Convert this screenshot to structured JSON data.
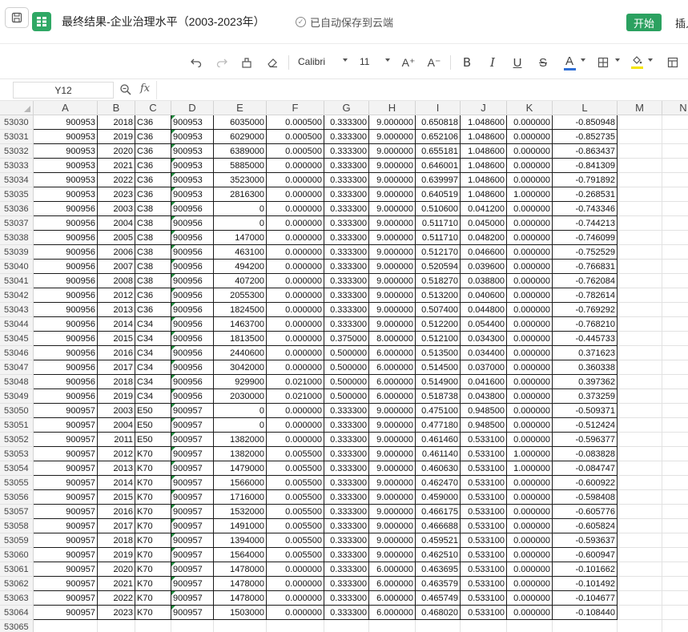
{
  "titlebar": {
    "doc_title": "最终结果-企业治理水平（2003-2023年）",
    "cloud_status": "已自动保存到云端",
    "start_label": "开始",
    "insert_label": "插入"
  },
  "toolbar": {
    "font_name": "Calibri",
    "font_size": "11",
    "bold": "B",
    "italic": "I",
    "underline": "U",
    "strike": "S",
    "font_color": "A",
    "increase_font": "A⁺",
    "decrease_font": "A⁻",
    "font_color_accent": "#2f6fd6",
    "fill_color_accent": "#f5e400"
  },
  "formula_bar": {
    "cell_ref": "Y12",
    "fx_label": "fx",
    "value": ""
  },
  "columns": [
    "A",
    "B",
    "C",
    "D",
    "E",
    "F",
    "G",
    "H",
    "I",
    "J",
    "K",
    "L",
    "M",
    "N"
  ],
  "rows": [
    {
      "n": "53030",
      "c": [
        "900953",
        "2018",
        "C36",
        "900953",
        "6035000",
        "0.000500",
        "0.333300",
        "9.000000",
        "0.650818",
        "1.048600",
        "0.000000",
        "-0.850948"
      ]
    },
    {
      "n": "53031",
      "c": [
        "900953",
        "2019",
        "C36",
        "900953",
        "6029000",
        "0.000500",
        "0.333300",
        "9.000000",
        "0.652106",
        "1.048600",
        "0.000000",
        "-0.852735"
      ]
    },
    {
      "n": "53032",
      "c": [
        "900953",
        "2020",
        "C36",
        "900953",
        "6389000",
        "0.000500",
        "0.333300",
        "9.000000",
        "0.655181",
        "1.048600",
        "0.000000",
        "-0.863437"
      ]
    },
    {
      "n": "53033",
      "c": [
        "900953",
        "2021",
        "C36",
        "900953",
        "5885000",
        "0.000000",
        "0.333300",
        "9.000000",
        "0.646001",
        "1.048600",
        "0.000000",
        "-0.841309"
      ]
    },
    {
      "n": "53034",
      "c": [
        "900953",
        "2022",
        "C36",
        "900953",
        "3523000",
        "0.000000",
        "0.333300",
        "9.000000",
        "0.639997",
        "1.048600",
        "0.000000",
        "-0.791892"
      ]
    },
    {
      "n": "53035",
      "c": [
        "900953",
        "2023",
        "C36",
        "900953",
        "2816300",
        "0.000000",
        "0.333300",
        "9.000000",
        "0.640519",
        "1.048600",
        "1.000000",
        "-0.268531"
      ]
    },
    {
      "n": "53036",
      "c": [
        "900956",
        "2003",
        "C38",
        "900956",
        "0",
        "0.000000",
        "0.333300",
        "9.000000",
        "0.510600",
        "0.041200",
        "0.000000",
        "-0.743346"
      ]
    },
    {
      "n": "53037",
      "c": [
        "900956",
        "2004",
        "C38",
        "900956",
        "0",
        "0.000000",
        "0.333300",
        "9.000000",
        "0.511710",
        "0.045000",
        "0.000000",
        "-0.744213"
      ]
    },
    {
      "n": "53038",
      "c": [
        "900956",
        "2005",
        "C38",
        "900956",
        "147000",
        "0.000000",
        "0.333300",
        "9.000000",
        "0.511710",
        "0.048200",
        "0.000000",
        "-0.746099"
      ]
    },
    {
      "n": "53039",
      "c": [
        "900956",
        "2006",
        "C38",
        "900956",
        "463100",
        "0.000000",
        "0.333300",
        "9.000000",
        "0.512170",
        "0.046600",
        "0.000000",
        "-0.752529"
      ]
    },
    {
      "n": "53040",
      "c": [
        "900956",
        "2007",
        "C38",
        "900956",
        "494200",
        "0.000000",
        "0.333300",
        "9.000000",
        "0.520594",
        "0.039600",
        "0.000000",
        "-0.766831"
      ]
    },
    {
      "n": "53041",
      "c": [
        "900956",
        "2008",
        "C38",
        "900956",
        "407200",
        "0.000000",
        "0.333300",
        "9.000000",
        "0.518270",
        "0.038800",
        "0.000000",
        "-0.762084"
      ]
    },
    {
      "n": "53042",
      "c": [
        "900956",
        "2012",
        "C36",
        "900956",
        "2055300",
        "0.000000",
        "0.333300",
        "9.000000",
        "0.513200",
        "0.040600",
        "0.000000",
        "-0.782614"
      ]
    },
    {
      "n": "53043",
      "c": [
        "900956",
        "2013",
        "C36",
        "900956",
        "1824500",
        "0.000000",
        "0.333300",
        "9.000000",
        "0.507400",
        "0.044800",
        "0.000000",
        "-0.769292"
      ]
    },
    {
      "n": "53044",
      "c": [
        "900956",
        "2014",
        "C34",
        "900956",
        "1463700",
        "0.000000",
        "0.333300",
        "9.000000",
        "0.512200",
        "0.054400",
        "0.000000",
        "-0.768210"
      ]
    },
    {
      "n": "53045",
      "c": [
        "900956",
        "2015",
        "C34",
        "900956",
        "1813500",
        "0.000000",
        "0.375000",
        "8.000000",
        "0.512100",
        "0.034300",
        "0.000000",
        "-0.445733"
      ]
    },
    {
      "n": "53046",
      "c": [
        "900956",
        "2016",
        "C34",
        "900956",
        "2440600",
        "0.000000",
        "0.500000",
        "6.000000",
        "0.513500",
        "0.034400",
        "0.000000",
        "0.371623"
      ]
    },
    {
      "n": "53047",
      "c": [
        "900956",
        "2017",
        "C34",
        "900956",
        "3042000",
        "0.000000",
        "0.500000",
        "6.000000",
        "0.514500",
        "0.037000",
        "0.000000",
        "0.360338"
      ]
    },
    {
      "n": "53048",
      "c": [
        "900956",
        "2018",
        "C34",
        "900956",
        "929900",
        "0.021000",
        "0.500000",
        "6.000000",
        "0.514900",
        "0.041600",
        "0.000000",
        "0.397362"
      ]
    },
    {
      "n": "53049",
      "c": [
        "900956",
        "2019",
        "C34",
        "900956",
        "2030000",
        "0.021000",
        "0.500000",
        "6.000000",
        "0.518738",
        "0.043800",
        "0.000000",
        "0.373259"
      ]
    },
    {
      "n": "53050",
      "c": [
        "900957",
        "2003",
        "E50",
        "900957",
        "0",
        "0.000000",
        "0.333300",
        "9.000000",
        "0.475100",
        "0.948500",
        "0.000000",
        "-0.509371"
      ]
    },
    {
      "n": "53051",
      "c": [
        "900957",
        "2004",
        "E50",
        "900957",
        "0",
        "0.000000",
        "0.333300",
        "9.000000",
        "0.477180",
        "0.948500",
        "0.000000",
        "-0.512424"
      ]
    },
    {
      "n": "53052",
      "c": [
        "900957",
        "2011",
        "E50",
        "900957",
        "1382000",
        "0.000000",
        "0.333300",
        "9.000000",
        "0.461460",
        "0.533100",
        "0.000000",
        "-0.596377"
      ]
    },
    {
      "n": "53053",
      "c": [
        "900957",
        "2012",
        "K70",
        "900957",
        "1382000",
        "0.005500",
        "0.333300",
        "9.000000",
        "0.461140",
        "0.533100",
        "1.000000",
        "-0.083828"
      ]
    },
    {
      "n": "53054",
      "c": [
        "900957",
        "2013",
        "K70",
        "900957",
        "1479000",
        "0.005500",
        "0.333300",
        "9.000000",
        "0.460630",
        "0.533100",
        "1.000000",
        "-0.084747"
      ]
    },
    {
      "n": "53055",
      "c": [
        "900957",
        "2014",
        "K70",
        "900957",
        "1566000",
        "0.005500",
        "0.333300",
        "9.000000",
        "0.462470",
        "0.533100",
        "0.000000",
        "-0.600922"
      ]
    },
    {
      "n": "53056",
      "c": [
        "900957",
        "2015",
        "K70",
        "900957",
        "1716000",
        "0.005500",
        "0.333300",
        "9.000000",
        "0.459000",
        "0.533100",
        "0.000000",
        "-0.598408"
      ]
    },
    {
      "n": "53057",
      "c": [
        "900957",
        "2016",
        "K70",
        "900957",
        "1532000",
        "0.005500",
        "0.333300",
        "9.000000",
        "0.466175",
        "0.533100",
        "0.000000",
        "-0.605776"
      ]
    },
    {
      "n": "53058",
      "c": [
        "900957",
        "2017",
        "K70",
        "900957",
        "1491000",
        "0.005500",
        "0.333300",
        "9.000000",
        "0.466688",
        "0.533100",
        "0.000000",
        "-0.605824"
      ]
    },
    {
      "n": "53059",
      "c": [
        "900957",
        "2018",
        "K70",
        "900957",
        "1394000",
        "0.005500",
        "0.333300",
        "9.000000",
        "0.459521",
        "0.533100",
        "0.000000",
        "-0.593637"
      ]
    },
    {
      "n": "53060",
      "c": [
        "900957",
        "2019",
        "K70",
        "900957",
        "1564000",
        "0.005500",
        "0.333300",
        "9.000000",
        "0.462510",
        "0.533100",
        "0.000000",
        "-0.600947"
      ]
    },
    {
      "n": "53061",
      "c": [
        "900957",
        "2020",
        "K70",
        "900957",
        "1478000",
        "0.000000",
        "0.333300",
        "6.000000",
        "0.463695",
        "0.533100",
        "0.000000",
        "-0.101662"
      ]
    },
    {
      "n": "53062",
      "c": [
        "900957",
        "2021",
        "K70",
        "900957",
        "1478000",
        "0.000000",
        "0.333300",
        "6.000000",
        "0.463579",
        "0.533100",
        "0.000000",
        "-0.101492"
      ]
    },
    {
      "n": "53063",
      "c": [
        "900957",
        "2022",
        "K70",
        "900957",
        "1478000",
        "0.000000",
        "0.333300",
        "6.000000",
        "0.465749",
        "0.533100",
        "0.000000",
        "-0.104677"
      ]
    },
    {
      "n": "53064",
      "c": [
        "900957",
        "2023",
        "K70",
        "900957",
        "1503000",
        "0.000000",
        "0.333300",
        "6.000000",
        "0.468020",
        "0.533100",
        "0.000000",
        "-0.108440"
      ]
    },
    {
      "n": "53065",
      "c": []
    }
  ]
}
